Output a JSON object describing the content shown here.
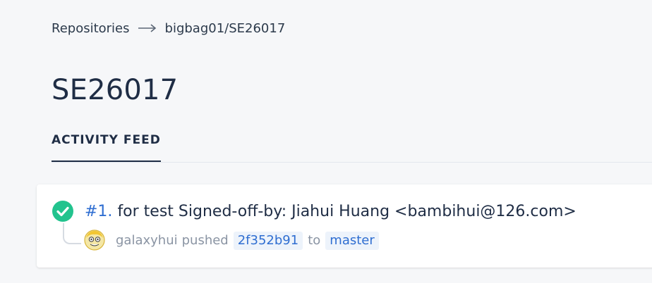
{
  "breadcrumb": {
    "root_label": "Repositories",
    "current_label": "bigbag01/SE26017"
  },
  "page": {
    "title": "SE26017"
  },
  "tabs": {
    "active_label": "ACTIVITY FEED"
  },
  "feed": {
    "items": [
      {
        "number": "#1.",
        "message": "for test Signed-off-by: Jiahui Huang <bambihui@126.com>",
        "user": "galaxyhui",
        "verb": "pushed",
        "commit": "2f352b91",
        "to": "to",
        "branch": "master",
        "status_icon": "check-circle-icon",
        "status_color": "#22c38e"
      }
    ]
  },
  "colors": {
    "link": "#2f6ed1",
    "chip_bg": "#edf3fb",
    "text_dark": "#1f2d45",
    "muted": "#8a94a3"
  }
}
